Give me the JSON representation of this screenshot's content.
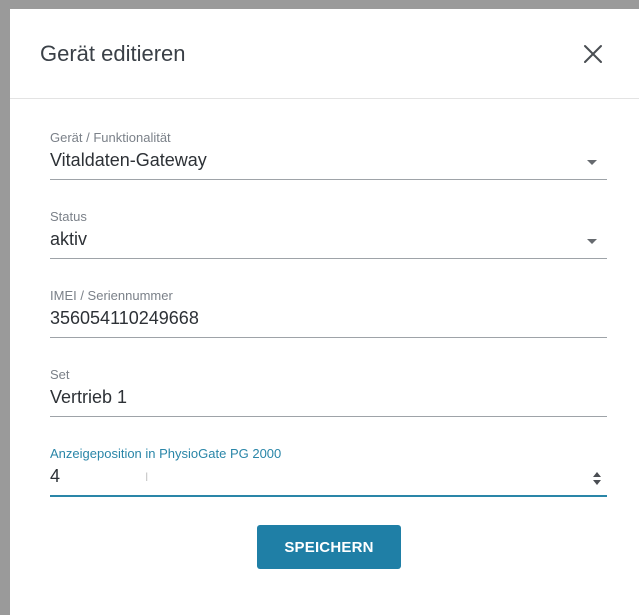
{
  "dialog": {
    "title": "Gerät editieren",
    "close_icon": "close-icon"
  },
  "fields": [
    {
      "label": "Gerät / Funktionalität",
      "value": "Vitaldaten-Gateway",
      "type": "select"
    },
    {
      "label": "Status",
      "value": "aktiv",
      "type": "select"
    },
    {
      "label": "IMEI / Seriennummer",
      "value": "356054110249668",
      "type": "text"
    },
    {
      "label": "Set",
      "value": "Vertrieb 1",
      "type": "text"
    },
    {
      "label": "Anzeigeposition in PhysioGate PG 2000",
      "value": "4",
      "type": "number",
      "focused": true
    }
  ],
  "actions": {
    "save_label": "SPEICHERN"
  },
  "colors": {
    "accent": "#1f7fa6",
    "focus": "#2a86a8",
    "label": "#7b8189",
    "text": "#2d3136"
  }
}
